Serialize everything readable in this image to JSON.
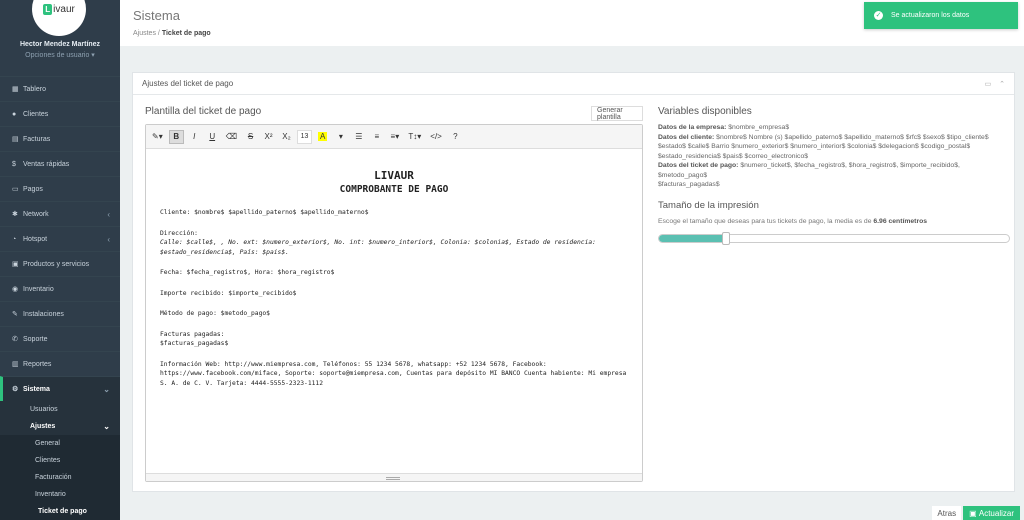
{
  "sidebar": {
    "logo": "ivaur",
    "user_name": "Hector Mendez Martínez",
    "user_options": "Opciones de usuario ▾",
    "items": [
      {
        "icon": "dashboard-icon",
        "glyph": "▦",
        "label": "Tablero"
      },
      {
        "icon": "users-icon",
        "glyph": "👥",
        "label": "Clientes"
      },
      {
        "icon": "invoice-icon",
        "glyph": "▤",
        "label": "Facturas"
      },
      {
        "icon": "dollar-icon",
        "glyph": "$",
        "label": "Ventas rápidas"
      },
      {
        "icon": "payments-icon",
        "glyph": "▭",
        "label": "Pagos"
      },
      {
        "icon": "network-icon",
        "glyph": "✱",
        "label": "Network"
      },
      {
        "icon": "wifi-icon",
        "glyph": "◔",
        "label": "Hotspot"
      },
      {
        "icon": "products-icon",
        "glyph": "▣",
        "label": "Productos y servicios"
      },
      {
        "icon": "inventory-icon",
        "glyph": "◉",
        "label": "Inventario"
      },
      {
        "icon": "installations-icon",
        "glyph": "✎",
        "label": "Instalaciones"
      },
      {
        "icon": "support-icon",
        "glyph": "✆",
        "label": "Soporte"
      },
      {
        "icon": "reports-icon",
        "glyph": "▥",
        "label": "Reportes"
      }
    ],
    "system": {
      "label": "Sistema",
      "glyph": "⚙"
    },
    "system_sub": [
      "Usuarios",
      "Ajustes"
    ],
    "settings_sub": [
      "General",
      "Clientes",
      "Facturación",
      "Inventario",
      "Ticket de pago"
    ]
  },
  "header": {
    "title": "Sistema",
    "crumb_parent": "Ajustes",
    "crumb_sep": "/",
    "crumb_current": "Ticket de pago"
  },
  "toast": {
    "text": "Se actualizaron los datos"
  },
  "panel": {
    "title": "Ajustes del ticket de pago",
    "tools": "▭ ⌃"
  },
  "template": {
    "title": "Plantilla del ticket de pago",
    "generate_label": "Generar plantilla",
    "toolbar": {
      "font_size": "13"
    },
    "doc": {
      "h1": "LIVAUR",
      "h2": "COMPROBANTE DE PAGO",
      "p1": "Cliente: $nombre$ $apellido_paterno$ $apellido_materno$",
      "p2a": "Dirección:",
      "p2b": "Calle: $calle$, , No. ext: $numero_exterior$, No. int: $numero_interior$, Colonia: $colonia$, Estado de residencia: $estado_residencia$, País: $pais$.",
      "p3": "Fecha: $fecha_registro$, Hora: $hora_registro$",
      "p4": "Importe recibido: $importe_recibido$",
      "p5": "Método de pago: $metodo_pago$",
      "p6a": "Facturas pagadas:",
      "p6b": "$facturas_pagadas$",
      "p7": "Información Web: http://www.miempresa.com, Teléfonos: 55 1234 5678, whatsapp: +52 1234 5678, Facebook: https://www.facebook.com/miface, Soporte: soporte@miempresa.com, Cuentas para depósito MI BANCO Cuenta habiente: Mi empresa S. A. de C. V. Tarjeta: 4444-5555-2323-1112"
    }
  },
  "variables": {
    "title": "Variables disponibles",
    "company_label": "Datos de la empresa:",
    "company_vars": "$nombre_empresa$",
    "client_label": "Datos del cliente:",
    "client_vars": "$nombre$ Nombre (s) $apellido_paterno$ $apellido_materno$ $rfc$ $sexo$ $tipo_cliente$ $estado$ $calle$ Barrio $numero_exterior$ $numero_interior$ $colonia$ $delegacion$ $codigo_postal$ $estado_residencia$ $pais$ $correo_electronico$",
    "ticket_label": "Datos del ticket de pago:",
    "ticket_vars": "$numero_ticket$, $fecha_registro$, $hora_registro$, $importe_recibido$, $metodo_pago$",
    "ticket_vars2": "$facturas_pagadas$"
  },
  "print_size": {
    "title": "Tamaño de la impresión",
    "desc": "Escoge el tamaño que deseas para tus tickets de pago, la media es de",
    "value": "6.96 centímetros",
    "slider_fraction": 0.19
  },
  "footer": {
    "back_label": "Atras",
    "save_label": "Actualizar"
  }
}
